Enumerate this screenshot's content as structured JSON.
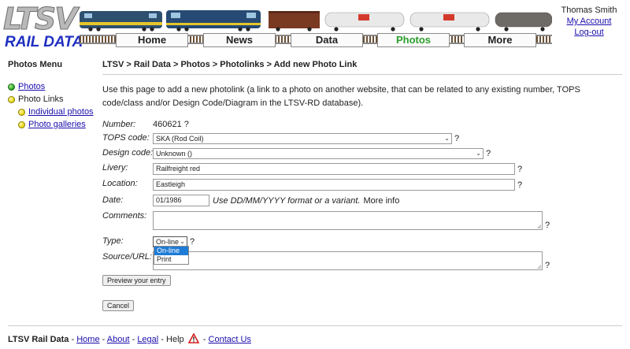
{
  "header": {
    "logo_text": "LTSV",
    "logo_subtext": "RAIL DATA",
    "nav": [
      {
        "label": "Home",
        "active": false
      },
      {
        "label": "News",
        "active": false
      },
      {
        "label": "Data",
        "active": false
      },
      {
        "label": "Photos",
        "active": true
      },
      {
        "label": "More",
        "active": false
      }
    ],
    "user_name": "Thomas Smith",
    "account_link": "My Account",
    "logout_link": "Log-out"
  },
  "sidebar": {
    "title": "Photos Menu",
    "items": [
      {
        "label": "Photos",
        "dot": "green",
        "link": true
      },
      {
        "label": "Photo Links",
        "dot": "yellow",
        "link": false
      },
      {
        "label": "Individual photos",
        "dot": "yellow",
        "link": true
      },
      {
        "label": "Photo galleries",
        "dot": "yellow",
        "link": true
      }
    ]
  },
  "main": {
    "breadcrumb": "LTSV > Rail Data > Photos > Photolinks > Add new Photo Link",
    "intro": "Use this page to add a new photolink (a link to a photo on another website, that can be related to any existing number, TOPS code/class and/or Design Code/Diagram in the LTSV-RD database).",
    "form": {
      "number_label": "Number:",
      "number_value": "460621",
      "tops_label": "TOPS code:",
      "tops_value": "SKA (Rod Coil)",
      "design_label": "Design code:",
      "design_value": "Unknown ()",
      "livery_label": "Livery:",
      "livery_value": "Railfreight red",
      "location_label": "Location:",
      "location_value": "Eastleigh",
      "date_label": "Date:",
      "date_value": "01/1986",
      "date_hint": "Use DD/MM/YYYY format or a variant.",
      "date_more": "More info",
      "comments_label": "Comments:",
      "comments_value": "",
      "type_label": "Type:",
      "type_value": "On-line",
      "type_options": [
        "On-line",
        "Print"
      ],
      "source_label": "Source/URL:",
      "source_value": "",
      "help_mark": "?",
      "preview_button": "Preview your entry",
      "cancel_button": "Cancel"
    }
  },
  "footer": {
    "site_name": "LTSV Rail Data",
    "links": [
      "Home",
      "About",
      "Legal"
    ],
    "help_label": "Help",
    "contact_link": "Contact Us"
  },
  "colors": {
    "link": "#1a0dab",
    "active_nav": "#2b9e2b",
    "logo_blue": "#1e2fc0",
    "dropdown_highlight": "#1e7bd6"
  }
}
